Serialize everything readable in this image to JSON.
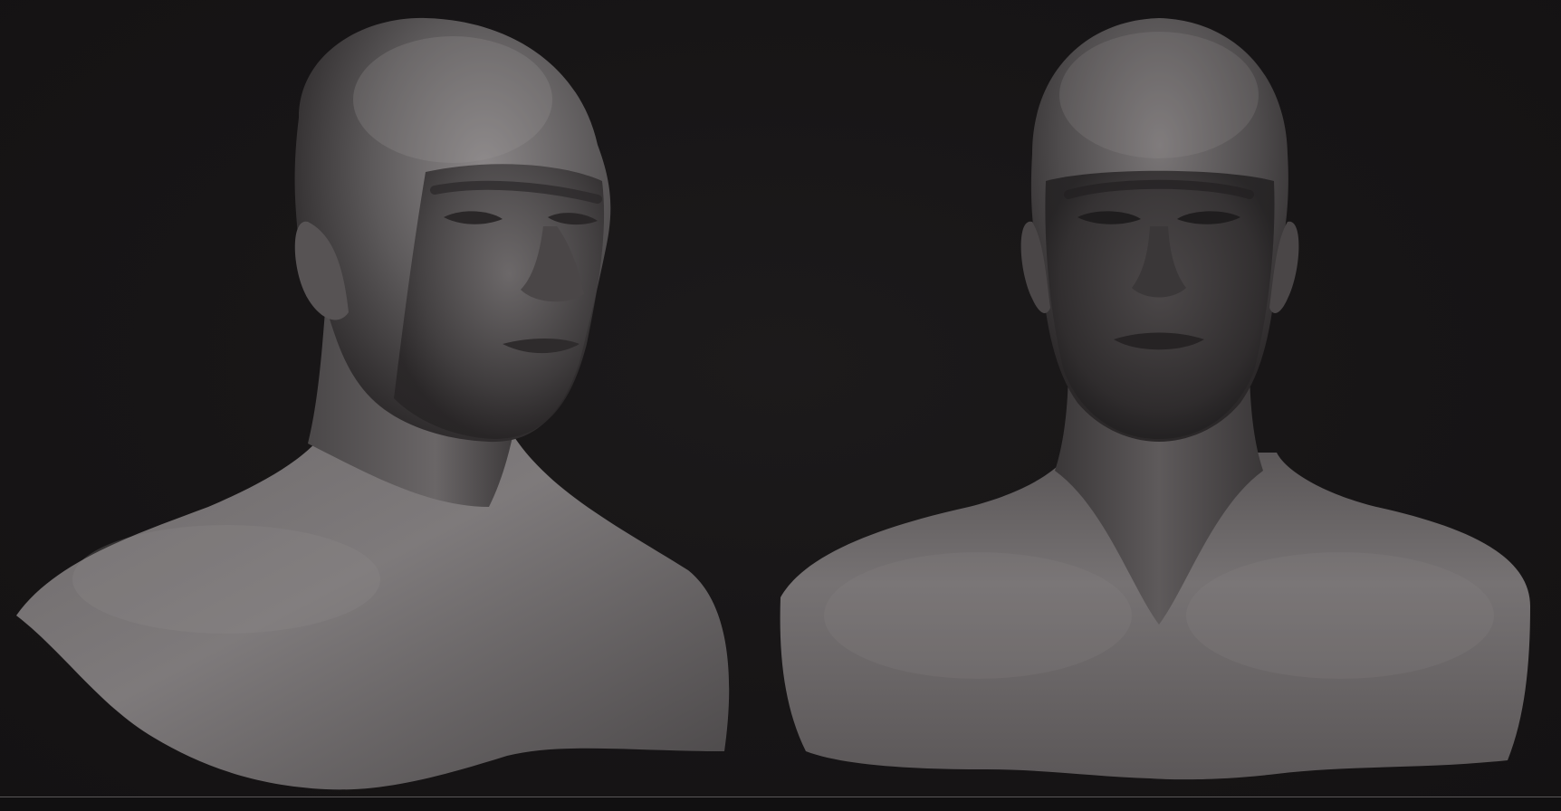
{
  "scene": {
    "background_color": "#161415",
    "clay_color": "#6e6b6c",
    "clay_highlight": "#8a8788",
    "clay_shadow": "#2e2b2c"
  },
  "sculpts": [
    {
      "name": "bust-three-quarter-view",
      "icon": "sculpt-bust-3q"
    },
    {
      "name": "bust-front-view",
      "icon": "sculpt-bust-front"
    }
  ]
}
